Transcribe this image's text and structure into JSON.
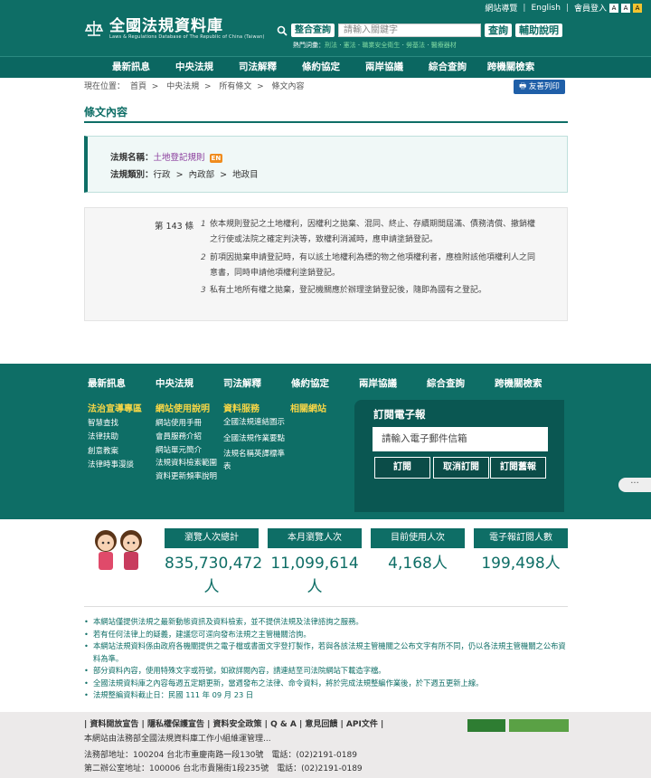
{
  "header": {
    "toplinks": [
      "網站導覽",
      "English",
      "會員登入"
    ],
    "font_sizes": [
      "A",
      "A",
      "A"
    ],
    "logo_title": "全國法規資料庫",
    "logo_sub": "Laws & Regulations Database of The Republic of China (Taiwan)",
    "search_type": "整合查詢",
    "search_placeholder": "請輸入關鍵字",
    "search_button": "查詢",
    "help_button": "輔助說明",
    "hot_label": "熱門詞彙：",
    "hot_terms": [
      "刑法",
      "憲法",
      "職業安全衛生",
      "勞基法",
      "醫療器材"
    ]
  },
  "nav": [
    "最新訊息",
    "中央法規",
    "司法解釋",
    "條約協定",
    "兩岸協議",
    "綜合查詢",
    "跨機關檢索"
  ],
  "breadcrumb": {
    "prefix": "現在位置：",
    "items": [
      "首頁",
      "中央法規",
      "所有條文",
      "條文內容"
    ],
    "sep": ">"
  },
  "print_button": "友善列印",
  "page_title": "條文內容",
  "law": {
    "name_label": "法規名稱：",
    "name": "土地登記規則",
    "en_badge": "EN",
    "category_label": "法規類別：",
    "categories": [
      "行政",
      "內政部",
      "地政目"
    ],
    "cat_sep": ">"
  },
  "article": {
    "number": "第 143 條",
    "paragraphs": [
      {
        "n": "1",
        "text": "依本規則登記之土地權利，因權利之拋棄、混同、終止、存續期間屆滿、債務清償、撤銷權之行使或法院之確定判決等，致權利消滅時，應申請塗銷登記。"
      },
      {
        "n": "2",
        "text": "前項因拋棄申請登記時，有以該土地權利為標的物之他項權利者，應檢附該他項權利人之同意書，同時申請他項權利塗銷登記。"
      },
      {
        "n": "3",
        "text": "私有土地所有權之拋棄，登記機關應於辦理塗銷登記後，隨即為國有之登記。"
      }
    ]
  },
  "footer": {
    "nav": [
      "最新訊息",
      "中央法規",
      "司法解釋",
      "條約協定",
      "兩岸協議",
      "綜合查詢",
      "跨機關檢索"
    ],
    "col1": {
      "title": "法治宣導專區",
      "items": [
        "智慧查找",
        "法律扶助",
        "創意教案",
        "法律時事漫談"
      ]
    },
    "col2": {
      "title": "網站使用說明",
      "items": [
        "網站使用手冊",
        "會員服務介紹",
        "網站單元簡介",
        "法規資料檢索範圍",
        "資料更新頻率說明"
      ]
    },
    "col3": {
      "title": "資料服務",
      "items": [
        "全國法規連結圖示",
        "全國法規作業要點",
        "法規名稱英譯標準表"
      ]
    },
    "col4": {
      "title": "相關網站",
      "items": []
    },
    "subscribe": {
      "title": "訂閱電子報",
      "placeholder": "請輸入電子郵件信箱",
      "buttons": [
        "訂閱",
        "取消訂閱",
        "訂閱舊報"
      ]
    }
  },
  "stats": [
    {
      "label": "瀏覽人次總計",
      "value": "835,730,472人"
    },
    {
      "label": "本月瀏覽人次",
      "value": "11,099,614人"
    },
    {
      "label": "目前使用人次",
      "value": "4,168人"
    },
    {
      "label": "電子報訂閱人數",
      "value": "199,498人"
    }
  ],
  "notes": [
    "本網站僅提供法規之最新動態資訊及資料檢索，並不提供法規及法律諮詢之服務。",
    "若有任何法律上的疑義，建議您可逕向發布法規之主管機關洽詢。",
    "本網站法規資料係由政府各機關提供之電子檔或書面文字登打製作，若與各該法規主管機關之公布文字有所不同，仍以各法規主管機關之公布資料為準。",
    "部分資料內容，使用特殊文字或符號，如欲詳閱內容，請連結至司法院網站下載造字檔。",
    "全國法規資料庫之內容每週五定期更新，當週發布之法律、命令資料，將於完成法規整編作業後，於下週五更新上線。",
    "法規整編資料截止日：民國 111 年 09 月 23 日"
  ],
  "bottom": {
    "links": "| 資料開放宣告 | 隱私權保護宣告 | 資料安全政策 | Q & A | 意見回饋 | API文件 |",
    "line2": "本網站由法務部全國法規資料庫工作小組維運管理...",
    "line3": "法務部地址：100204 台北市重慶南路一段130號　電話：(02)2191-0189",
    "line4": "第二辦公室地址：100006 台北市貴陽街1段235號　電話：(02)2191-0189"
  }
}
